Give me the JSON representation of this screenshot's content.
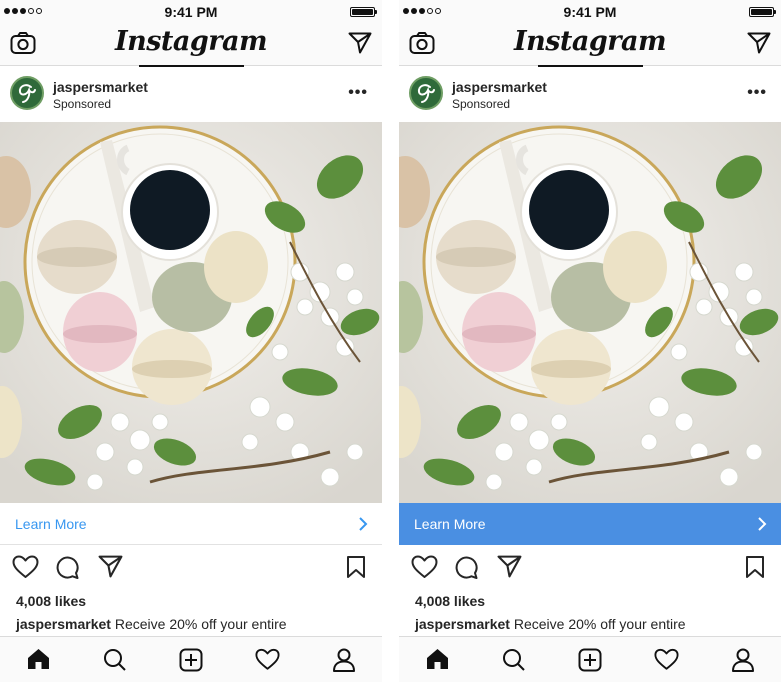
{
  "status": {
    "time": "9:41 PM"
  },
  "header": {
    "app_name": "Instagram"
  },
  "post": {
    "username": "jaspersmarket",
    "sponsored_label": "Sponsored",
    "more_label": "•••",
    "likes": "4,008 likes",
    "caption_user": "jaspersmarket",
    "caption_text": "Receive 20% off your entire"
  },
  "cta": {
    "label": "Learn More"
  },
  "colors": {
    "cta_active": "#4a8fe2",
    "cta_link": "#3897f0",
    "brand_green": "#2f6a3a"
  },
  "icons": {
    "nav": [
      "camera-icon",
      "direct-message-icon"
    ],
    "actions": [
      "heart-icon",
      "comment-icon",
      "share-icon",
      "bookmark-icon"
    ],
    "tabs": [
      "home-icon",
      "search-icon",
      "add-post-icon",
      "activity-heart-icon",
      "profile-icon"
    ]
  }
}
